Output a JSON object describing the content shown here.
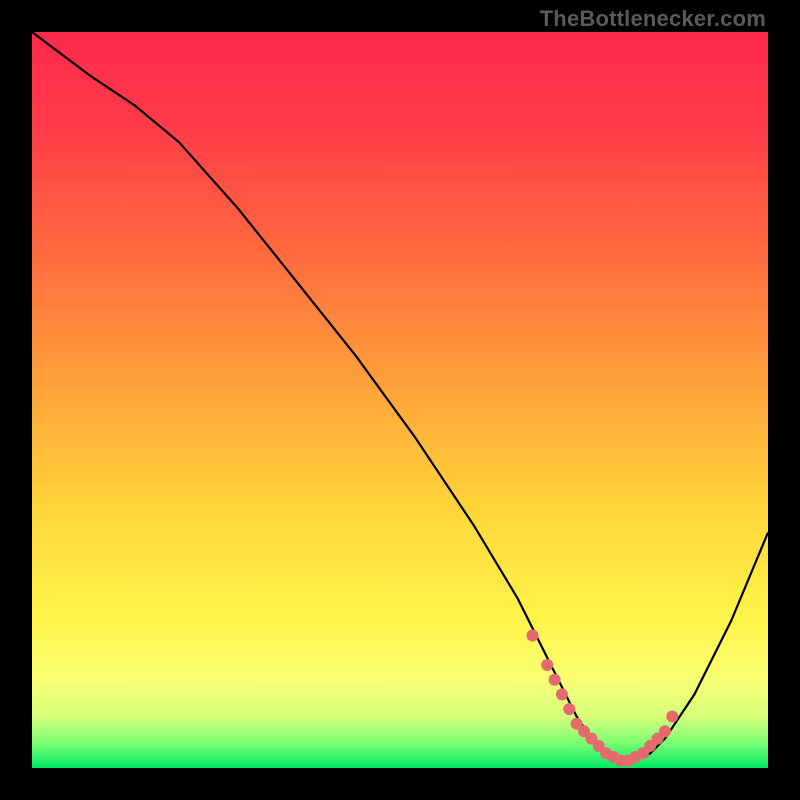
{
  "watermark": "TheBottlenecker.com",
  "chart_data": {
    "type": "line",
    "title": "",
    "xlabel": "",
    "ylabel": "",
    "xlim": [
      0,
      100
    ],
    "ylim": [
      0,
      100
    ],
    "gradient_stops": [
      {
        "offset": 0.0,
        "color": "#ff2a4d"
      },
      {
        "offset": 0.12,
        "color": "#ff3a49"
      },
      {
        "offset": 0.3,
        "color": "#ff6a3f"
      },
      {
        "offset": 0.48,
        "color": "#ffa23a"
      },
      {
        "offset": 0.66,
        "color": "#ffd93a"
      },
      {
        "offset": 0.8,
        "color": "#fff44a"
      },
      {
        "offset": 0.88,
        "color": "#f9ff74"
      },
      {
        "offset": 0.93,
        "color": "#d6ff7a"
      },
      {
        "offset": 0.965,
        "color": "#7dff74"
      },
      {
        "offset": 1.0,
        "color": "#00e864"
      }
    ],
    "series": [
      {
        "name": "bottleneck-curve",
        "x": [
          0,
          4,
          8,
          14,
          20,
          28,
          36,
          44,
          52,
          60,
          66,
          70,
          72,
          74,
          76,
          78,
          80,
          82,
          84,
          86,
          90,
          95,
          100
        ],
        "y": [
          100,
          97,
          94,
          90,
          85,
          76,
          66,
          56,
          45,
          33,
          23,
          15,
          11,
          7,
          4,
          2,
          1,
          1,
          2,
          4,
          10,
          20,
          32
        ]
      }
    ],
    "markers": {
      "name": "optimal-range",
      "color": "#e46a6e",
      "x": [
        68,
        70,
        71,
        72,
        73,
        74,
        75,
        76,
        77,
        78,
        79,
        80,
        81,
        82,
        83,
        84,
        85,
        86,
        87
      ],
      "y": [
        18,
        14,
        12,
        10,
        8,
        6,
        5,
        4,
        3,
        2,
        1.5,
        1,
        1,
        1.5,
        2,
        3,
        4,
        5,
        7
      ]
    }
  }
}
